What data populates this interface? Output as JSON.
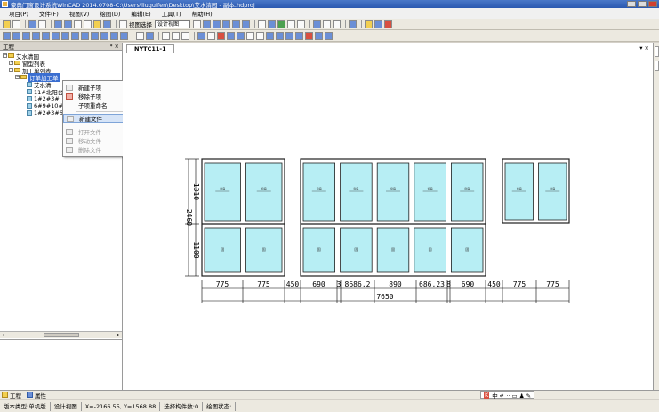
{
  "window": {
    "title": "豪典门窗设计系统WinCAD 2014.0708-C:\\Users\\liuguifen\\Desktop\\艾水清园 - 副本.hdproj"
  },
  "menu": [
    "项目(P)",
    "文件(F)",
    "视图(V)",
    "绘图(D)",
    "编辑(E)",
    "工具(T)",
    "帮助(H)"
  ],
  "toolbar": {
    "view_label": "视图选择",
    "view_value": "设计视图"
  },
  "left_panel": {
    "title": "工程",
    "pin": "ᵠ",
    "close": "×"
  },
  "tree": [
    {
      "label": "艾水清园",
      "type": "folder",
      "expander": "−"
    },
    {
      "label": "窗型列表",
      "type": "folder",
      "expander": "+"
    },
    {
      "label": "加工单列表",
      "type": "folder",
      "expander": "−"
    },
    {
      "label": "订单加工单",
      "type": "folder",
      "expander": "−",
      "selected": true
    },
    {
      "label": "艾水清",
      "type": "file"
    },
    {
      "label": "11#北阳台",
      "type": "file"
    },
    {
      "label": "1#2#3#",
      "type": "file"
    },
    {
      "label": "6#9#10#",
      "type": "file"
    },
    {
      "label": "1#2#3#6#",
      "type": "file"
    }
  ],
  "context_menu": [
    {
      "label": "新建子项",
      "state": "normal"
    },
    {
      "label": "移除子项",
      "state": "normal"
    },
    {
      "label": "子项重命名",
      "state": "normal"
    },
    {
      "label": "新建文件",
      "state": "highlight"
    },
    {
      "label": "打开文件",
      "state": "disabled"
    },
    {
      "label": "移动文件",
      "state": "disabled"
    },
    {
      "label": "删除文件",
      "state": "disabled"
    }
  ],
  "doc": {
    "tab": "NYTC11-1",
    "close": "▾ ×"
  },
  "drawing": {
    "left_dims": [
      "1310",
      "1100"
    ],
    "total_height": "2460",
    "bottom_dims": [
      "775",
      "775",
      "450",
      "690",
      "3",
      "8686.2",
      "890",
      "686.23",
      "8",
      "690",
      "450",
      "775",
      "775"
    ],
    "total_width": "7650",
    "glass_colors": {
      "fill": "#b7eef4",
      "frame": "#1e1e1e"
    },
    "sash_label": "窗扇",
    "fixed_label": "固"
  },
  "bottom_tabs": [
    "工程",
    "属性"
  ],
  "ime": "中 ↵ ·· ▭ ♟ ✎",
  "ime_badge": "K",
  "status": {
    "version": "版本类型:单机版",
    "view": "设计视图",
    "coords": "X=-2166.55, Y=1568.88",
    "selection": "选择构件数:0",
    "drawing_state": "绘图状态:"
  }
}
